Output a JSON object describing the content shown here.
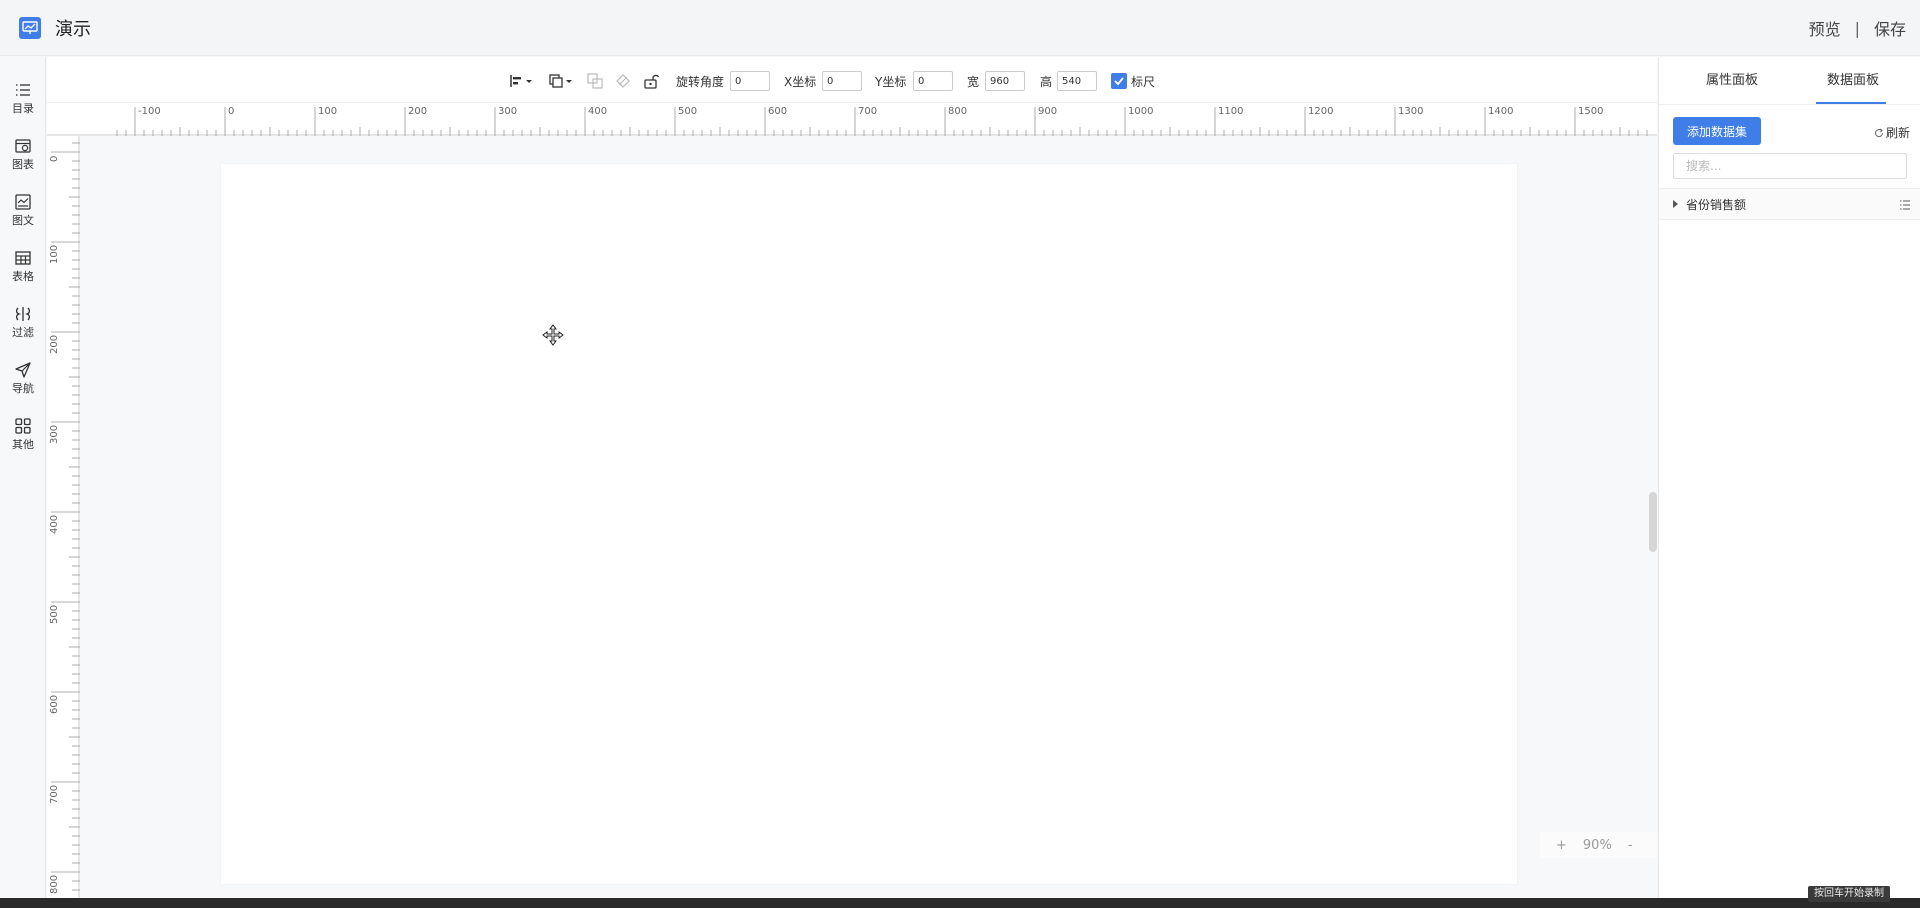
{
  "header": {
    "title": "演示",
    "preview_label": "预览",
    "separator": "|",
    "save_label": "保存",
    "accent_color": "#3f7ee8"
  },
  "sidebar": {
    "items": [
      {
        "label": "目录",
        "icon": "list-icon"
      },
      {
        "label": "图表",
        "icon": "chart-icon"
      },
      {
        "label": "图文",
        "icon": "image-text-icon"
      },
      {
        "label": "表格",
        "icon": "table-icon"
      },
      {
        "label": "过滤",
        "icon": "filter-icon"
      },
      {
        "label": "导航",
        "icon": "navigation-icon"
      },
      {
        "label": "其他",
        "icon": "grid-icon"
      }
    ]
  },
  "toolbar": {
    "rotation_label": "旋转角度",
    "rotation_value": "0",
    "x_label": "X坐标",
    "x_value": "0",
    "y_label": "Y坐标",
    "y_value": "0",
    "width_label": "宽",
    "width_value": "960",
    "height_label": "高",
    "height_value": "540",
    "ruler_label": "标尺",
    "ruler_checked": true
  },
  "rulers": {
    "horizontal_ticks": [
      "-100",
      "0",
      "100",
      "200",
      "300",
      "400",
      "500",
      "600",
      "700",
      "800",
      "900",
      "1000",
      "1100",
      "1200",
      "1300",
      "1400",
      "1500"
    ],
    "vertical_ticks": [
      "0",
      "100",
      "200",
      "300",
      "400",
      "500",
      "600",
      "700",
      "800"
    ]
  },
  "canvas": {
    "zoom_plus": "+",
    "zoom_level": "90%",
    "zoom_minus": "-"
  },
  "right_panel": {
    "tabs": [
      "属性面板",
      "数据面板"
    ],
    "active_tab": "数据面板",
    "add_dataset_label": "添加数据集",
    "refresh_label": "刷新",
    "search_placeholder": "搜索...",
    "datasets": [
      "省份销售额"
    ]
  },
  "footer": {
    "note": "按回车开始录制"
  }
}
